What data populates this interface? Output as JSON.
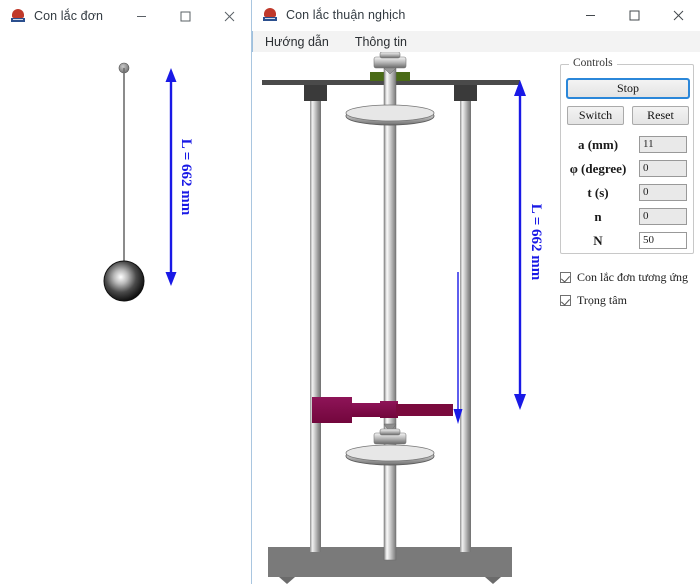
{
  "left_window": {
    "title": "Con lắc đơn",
    "icon": "app-logo-icon",
    "buttons": {
      "minimize": "minimize-icon",
      "maximize": "maximize-icon",
      "close": "close-icon"
    },
    "simple_pendulum": {
      "length_label": "L = 662 mm",
      "length_value": 662,
      "length_unit": "mm",
      "arrow_color": "#1919e6"
    }
  },
  "right_window": {
    "title": "Con lắc thuận nghịch",
    "icon": "app-logo-icon",
    "buttons": {
      "minimize": "minimize-icon",
      "maximize": "maximize-icon",
      "close": "close-icon"
    },
    "menu": [
      {
        "label": "Hướng dẫn"
      },
      {
        "label": "Thông tin"
      }
    ],
    "apparatus": {
      "length_label": "L = 662 mm",
      "length_value": 662,
      "length_unit": "mm",
      "arrow_color": "#1919e6",
      "weight_color": "#8c0f4f",
      "clamp_color": "#4a6b17",
      "base_color": "#7a7a7a"
    },
    "controls": {
      "legend": "Controls",
      "stop_button": "Stop",
      "switch_button": "Switch",
      "reset_button": "Reset",
      "fields": [
        {
          "label": "a (mm)",
          "value": "11",
          "editable": false
        },
        {
          "label": "φ (degree)",
          "value": "0",
          "editable": false
        },
        {
          "label": "t (s)",
          "value": "0",
          "editable": false
        },
        {
          "label": "n",
          "value": "0",
          "editable": false
        },
        {
          "label": "N",
          "value": "50",
          "editable": true
        }
      ],
      "checkboxes": [
        {
          "label": "Con lắc đơn tương ứng",
          "checked": true
        },
        {
          "label": "Trọng tâm",
          "checked": true
        }
      ]
    }
  }
}
